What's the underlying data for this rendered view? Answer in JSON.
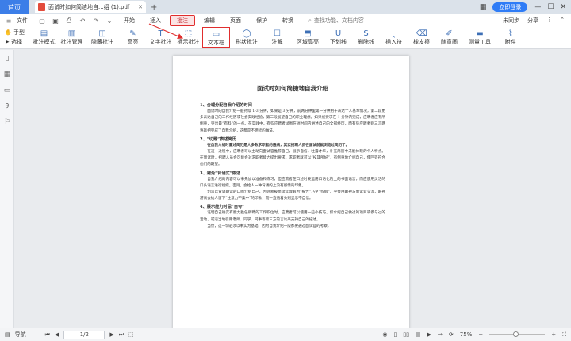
{
  "tabs": {
    "home": "首页",
    "doc_title": "面试时如何简洁地自...绍 (1).pdf"
  },
  "titlebar": {
    "login": "立即登录"
  },
  "menu": {
    "file": "文件",
    "items": [
      "开始",
      "插入",
      "批注",
      "编辑",
      "页面",
      "保护",
      "转换"
    ],
    "search_placeholder": "查找功能、文档内容",
    "right": [
      "未同步",
      "分享"
    ]
  },
  "toolbar": {
    "hand": "手型",
    "select": "选择",
    "tools": [
      "批注模式",
      "批注管理",
      "隐藏批注",
      "高亮",
      "文字批注",
      "插示批注",
      "文本框",
      "形状批注",
      "注解",
      "区域高亮",
      "下划线",
      "删除线",
      "插入符",
      "橡皮擦",
      "随意画",
      "测量工具",
      "附件"
    ]
  },
  "sidebar_icons": [
    "bookmark-icon",
    "thumbnail-icon",
    "comment-icon",
    "attachment-icon",
    "stamp-icon"
  ],
  "document": {
    "title": "面试时如何简捷地自我介绍",
    "blocks": [
      {
        "k": "h",
        "t": "1、合理分配自我介绍的时间"
      },
      {
        "k": "p",
        "t": "面试时的自我介绍一般持续 1-3 分钟，如果是 3 分钟，前两分钟里第一分钟用于表达个人基本情况，第二段更多表达自己的工作经历或社会实践经验，第三段展望自己的职业理想。如果被要求在 1 分钟内完成，应聘者应有所侧重，突出最“有料”的一点。在实践中，有些应聘者试图在短时间内讲述自己的全部经历，而有些应聘者则三言两语就把完成了自我介绍，这都是不明智的做法。"
      },
      {
        "k": "h",
        "t": "2、“切题”表述简历"
      },
      {
        "k": "pb",
        "t": "在自我介绍时重述简历是大多数求职者的通病，其实招聘人员在面试前就浏览过简历了。"
      },
      {
        "k": "p",
        "t": "在这一过程中，应聘者可以主动向面试官推荐自己，展示自信，吐露才华，补充简历中未能体现的个人特点。在面试时，招聘人员会可能会对求职者能力提出要求，求职者就可以“投其所好”，有侧重地介绍自己，使回答符合他们的期望。"
      },
      {
        "k": "h",
        "t": "3、避免“背诵式”陈述"
      },
      {
        "k": "p",
        "t": "自我介绍的内容可以事先加以准备和练习，但应聘者在口述时要运用口语化的上的书面语言，而应使用灵活的口头语言进行组织。否则，会给人一种背诵的上没有感情的印象。"
      },
      {
        "k": "p",
        "t": "切忌以背诵朗读的口吻介绍自己，否则易被面试官理解为“报告”乃至“作假”。学会用眼神与面试官交流，眼神游离会给人留下“注意力不集中”的印象，而一直低着头则显示不自信。"
      },
      {
        "k": "h",
        "t": "4、展示能力时忌“自夸”"
      },
      {
        "k": "p",
        "t": "证明自己确实有能力胜任所聘的工作职位时，应聘者可以使用一些小技巧，如介绍自己做过的项目或参与过的活动，或适当地引用老师、同学、同事等第三方的言论来支持自己的描述。"
      },
      {
        "k": "p",
        "t": "当然，这一切必须以事实为基础，因为自我介绍一般都要通过面试官的考察，"
      }
    ]
  },
  "statusbar": {
    "nav": "导航",
    "page": "1/2",
    "zoom": "75%"
  }
}
